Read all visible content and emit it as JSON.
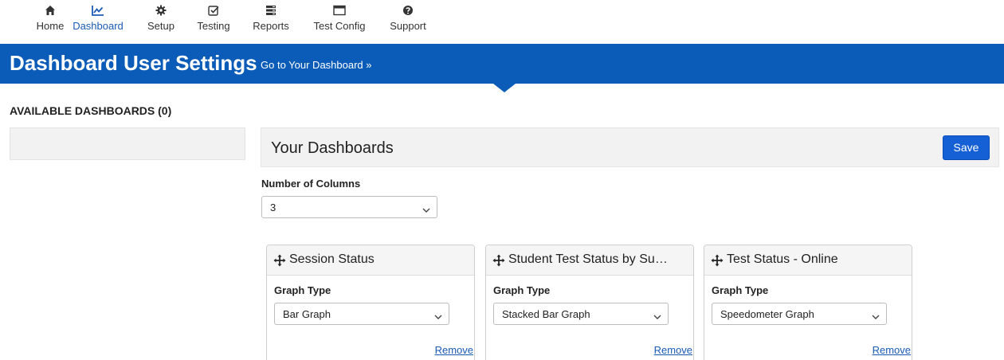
{
  "nav": {
    "items": [
      {
        "label": "Home",
        "icon": "home-icon"
      },
      {
        "label": "Dashboard",
        "icon": "dashboard-chart-icon",
        "active": true
      },
      {
        "label": "Setup",
        "icon": "gear-icon"
      },
      {
        "label": "Testing",
        "icon": "checkbox-icon"
      },
      {
        "label": "Reports",
        "icon": "reports-icon"
      },
      {
        "label": "Test Config",
        "icon": "window-icon"
      },
      {
        "label": "Support",
        "icon": "help-icon"
      }
    ]
  },
  "banner": {
    "title": "Dashboard User Settings",
    "link": "Go to Your Dashboard »"
  },
  "available": {
    "heading": "AVAILABLE DASHBOARDS (0)"
  },
  "your_dashboards": {
    "title": "Your Dashboards",
    "save_label": "Save",
    "columns_label": "Number of Columns",
    "columns_value": "3"
  },
  "cards": [
    {
      "title": "Session Status",
      "graph_label": "Graph Type",
      "graph_value": "Bar Graph",
      "remove_label": "Remove"
    },
    {
      "title": "Student Test Status by Su…",
      "graph_label": "Graph Type",
      "graph_value": "Stacked Bar Graph",
      "remove_label": "Remove"
    },
    {
      "title": "Test Status - Online",
      "graph_label": "Graph Type",
      "graph_value": "Speedometer Graph",
      "remove_label": "Remove"
    }
  ],
  "colors": {
    "banner": "#0b5cb8",
    "accent": "#1560d4",
    "link": "#1a5bb5",
    "panel": "#f2f2f2"
  }
}
